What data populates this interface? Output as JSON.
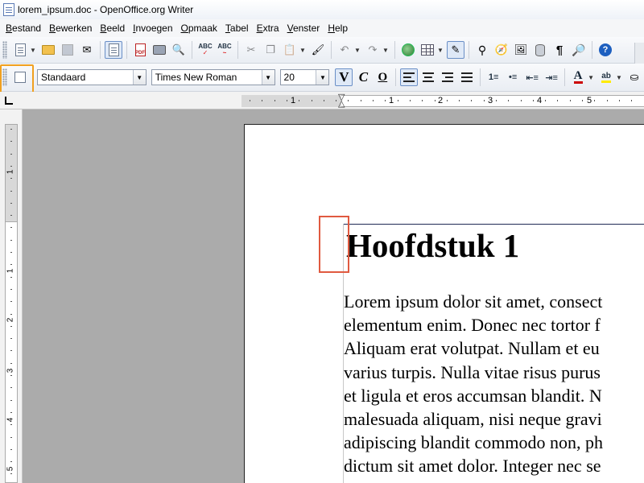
{
  "window": {
    "title": "lorem_ipsum.doc - OpenOffice.org Writer"
  },
  "menu": [
    {
      "label": "Bestand"
    },
    {
      "label": "Bewerken"
    },
    {
      "label": "Beeld"
    },
    {
      "label": "Invoegen"
    },
    {
      "label": "Opmaak"
    },
    {
      "label": "Tabel"
    },
    {
      "label": "Extra"
    },
    {
      "label": "Venster"
    },
    {
      "label": "Help"
    }
  ],
  "formatting": {
    "paragraph_style": "Standaard",
    "font_name": "Times New Roman",
    "font_size": "20",
    "bold_glyph": "V",
    "italic_glyph": "C",
    "underline_glyph": "O",
    "font_color_glyph": "A",
    "highlight_glyph": "ab",
    "font_color": "#cc0000",
    "highlight_color": "#ffeb00"
  },
  "ruler": {
    "horizontal": [
      "1",
      "1",
      "2",
      "3",
      "4",
      "5"
    ],
    "vertical": [
      "1",
      "1",
      "2",
      "3",
      "4",
      "5"
    ]
  },
  "document": {
    "heading": "Hoofdstuk 1",
    "lines": [
      "Lorem ipsum dolor sit amet, consect",
      "elementum enim. Donec nec tortor f",
      "Aliquam erat volutpat. Nullam et eu",
      "varius turpis. Nulla vitae risus purus",
      "et ligula et eros accumsan blandit. N",
      "malesuada aliquam, nisi neque gravi",
      "adipiscing blandit commodo non, ph",
      "dictum sit amet dolor. Integer nec se"
    ]
  },
  "highlights": {
    "toolbar_frame_color": "#f0a020",
    "cursor_frame_color": "#e05a40"
  }
}
